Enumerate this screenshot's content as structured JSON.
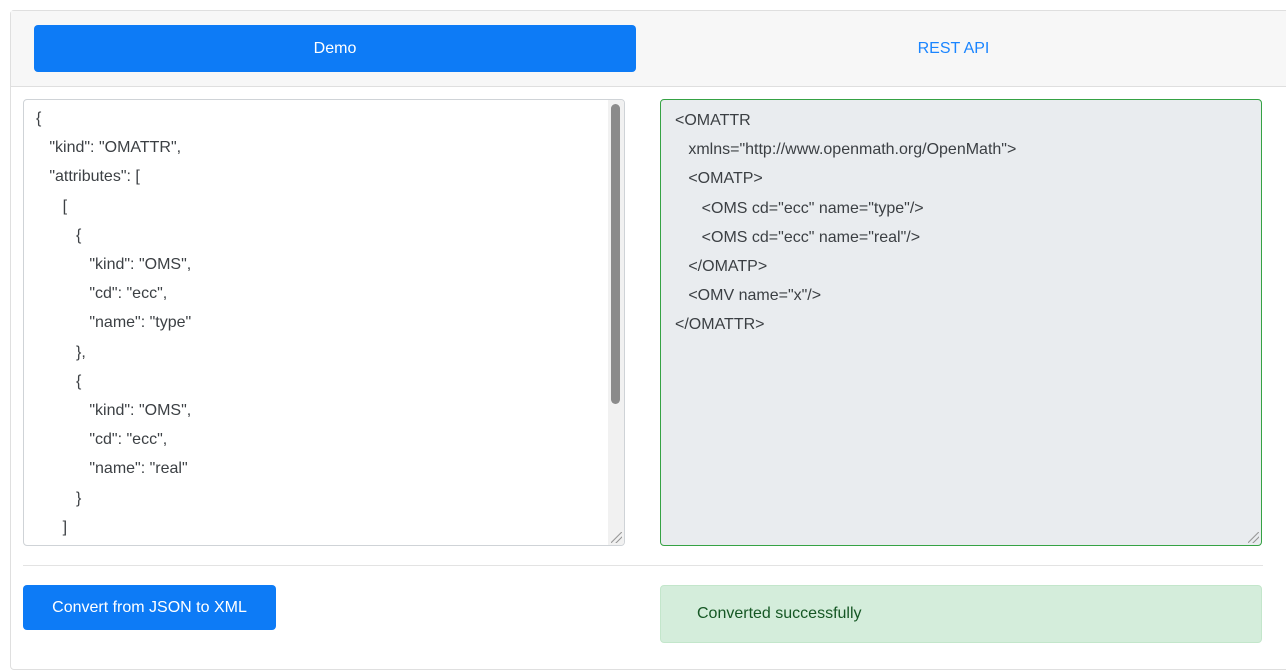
{
  "tabs": {
    "demo": "Demo",
    "rest_api": "REST API"
  },
  "json_input": {
    "value": "{\n   \"kind\": \"OMATTR\",\n   \"attributes\": [\n      [\n         {\n            \"kind\": \"OMS\",\n            \"cd\": \"ecc\",\n            \"name\": \"type\"\n         },\n         {\n            \"kind\": \"OMS\",\n            \"cd\": \"ecc\",\n            \"name\": \"real\"\n         }\n      ]\n   ]"
  },
  "xml_output": {
    "value": "<OMATTR\n   xmlns=\"http://www.openmath.org/OpenMath\">\n   <OMATP>\n      <OMS cd=\"ecc\" name=\"type\"/>\n      <OMS cd=\"ecc\" name=\"real\"/>\n   </OMATP>\n   <OMV name=\"x\"/>\n</OMATTR>"
  },
  "actions": {
    "convert_label": "Convert from JSON to XML"
  },
  "status": {
    "message": "Converted successfully"
  },
  "colors": {
    "primary": "#0d7bf6",
    "link": "#1a85ff",
    "success_border": "#35a244",
    "success_bg": "#d4eddb",
    "success_text": "#155724"
  }
}
